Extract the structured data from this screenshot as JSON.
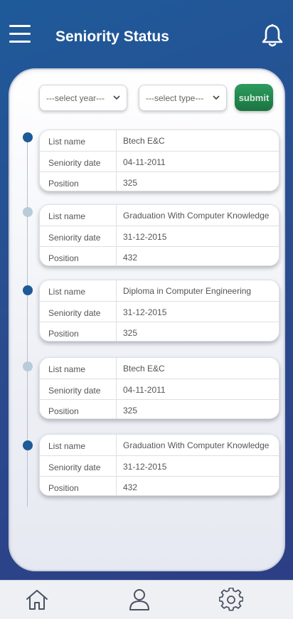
{
  "header": {
    "title": "Seniority Status",
    "menu_icon": "hamburger-menu-icon",
    "notification_icon": "bell-icon"
  },
  "filters": {
    "year_select": "---select year---",
    "type_select": "---select type---",
    "submit_label": "submit"
  },
  "labels": {
    "list_name": "List name",
    "seniority_date": "Seniority date",
    "position": "Position"
  },
  "records": [
    {
      "list_name": "Btech E&C",
      "seniority_date": "04-11-2011",
      "position": "325",
      "dot": "dark"
    },
    {
      "list_name": "Graduation With Computer Knowledge",
      "seniority_date": "31-12-2015",
      "position": "432",
      "dot": "light"
    },
    {
      "list_name": "Diploma in Computer Engineering",
      "seniority_date": "31-12-2015",
      "position": "325",
      "dot": "dark"
    },
    {
      "list_name": "Btech E&C",
      "seniority_date": "04-11-2011",
      "position": "325",
      "dot": "light"
    },
    {
      "list_name": "Graduation With Computer Knowledge",
      "seniority_date": "31-12-2015",
      "position": "432",
      "dot": "dark"
    }
  ],
  "bottom_nav": {
    "items": [
      "home-icon",
      "user-icon",
      "settings-icon"
    ]
  },
  "colors": {
    "background": "#2a4d8f",
    "accent": "#1d5a97",
    "submit": "#1f8049"
  }
}
